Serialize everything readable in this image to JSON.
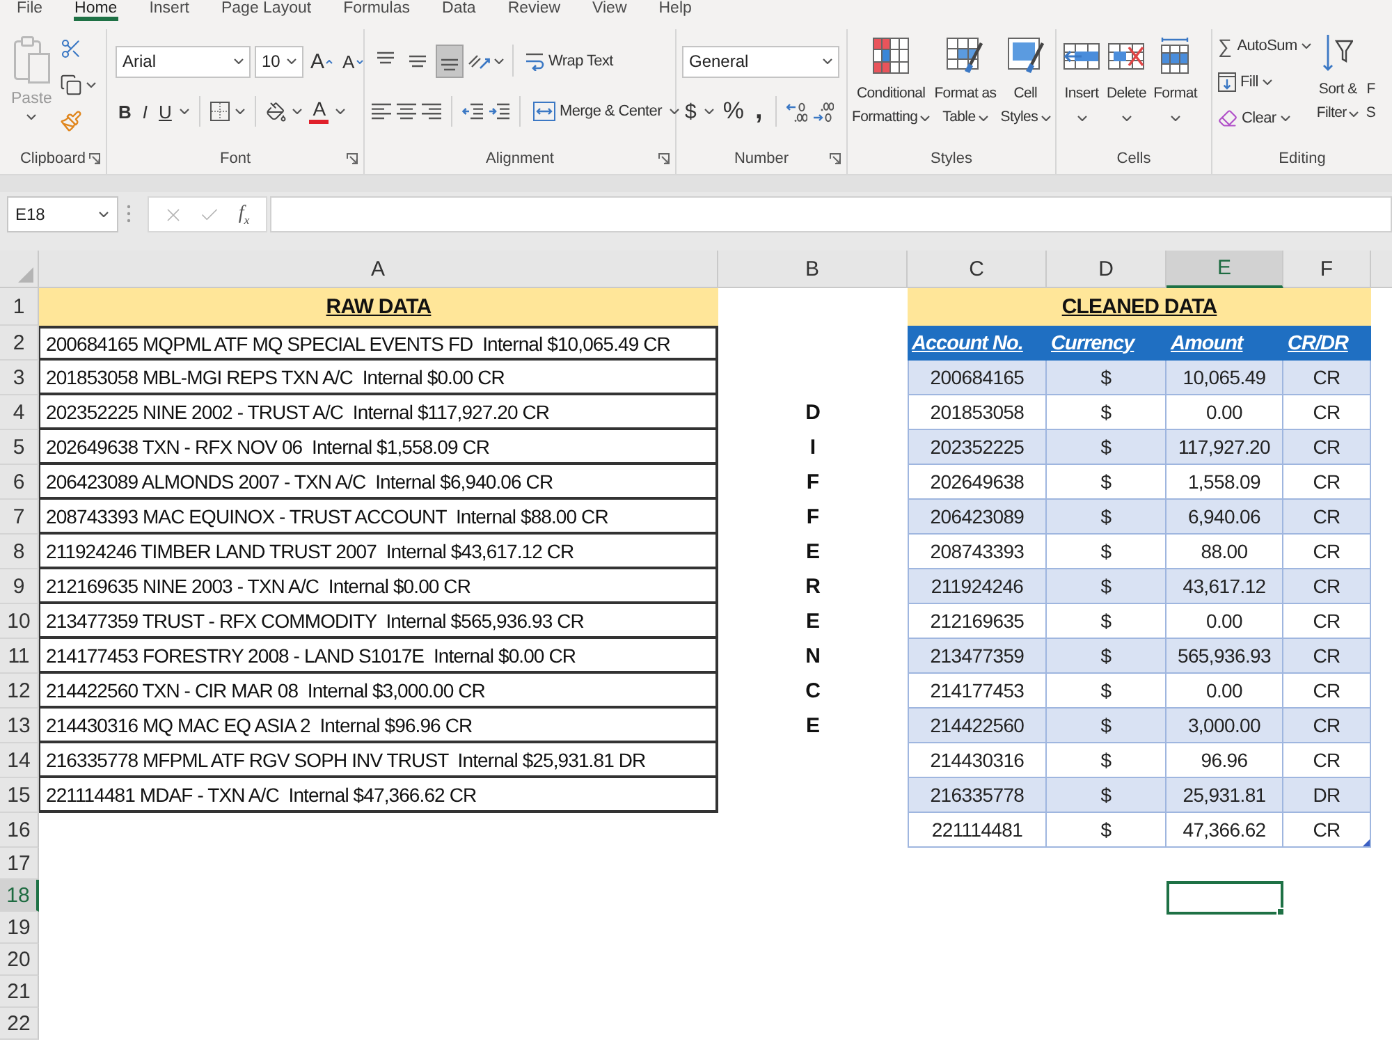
{
  "tabs": [
    {
      "label": "File",
      "selected": false
    },
    {
      "label": "Home",
      "selected": true
    },
    {
      "label": "Insert",
      "selected": false
    },
    {
      "label": "Page Layout",
      "selected": false
    },
    {
      "label": "Formulas",
      "selected": false
    },
    {
      "label": "Data",
      "selected": false
    },
    {
      "label": "Review",
      "selected": false
    },
    {
      "label": "View",
      "selected": false
    },
    {
      "label": "Help",
      "selected": false
    }
  ],
  "ribbon": {
    "clipboard": {
      "label": "Clipboard",
      "paste": {
        "label": "Paste",
        "disabled": true
      }
    },
    "font": {
      "label": "Font",
      "font_name": "Arial",
      "font_size": "10",
      "grow": "A",
      "shrink": "A",
      "bold": "B",
      "italic": "I",
      "underline": "U",
      "font_color": "A"
    },
    "alignment": {
      "label": "Alignment",
      "vertical": [
        {
          "kind": "top",
          "selected": false
        },
        {
          "kind": "middle",
          "selected": false
        },
        {
          "kind": "bottom",
          "selected": true
        }
      ],
      "wrap_text": "Wrap Text",
      "merge": "Merge & Center"
    },
    "number": {
      "label": "Number",
      "format": "General",
      "currency": "$",
      "percent": "%",
      "comma": ","
    },
    "styles": {
      "label": "Styles",
      "buttons": [
        {
          "kind": "conditional",
          "lines": [
            "Conditional",
            "Formatting"
          ]
        },
        {
          "kind": "table",
          "lines": [
            "Format as",
            "Table"
          ]
        },
        {
          "kind": "cell",
          "lines": [
            "Cell",
            "Styles"
          ]
        }
      ]
    },
    "cells": {
      "label": "Cells",
      "buttons": [
        {
          "kind": "insert",
          "label": "Insert"
        },
        {
          "kind": "delete",
          "label": "Delete"
        },
        {
          "kind": "format",
          "label": "Format"
        }
      ]
    },
    "editing": {
      "label": "Editing",
      "autosum_symbol": "∑",
      "autosum": "AutoSum",
      "fill": "Fill",
      "clear": "Clear",
      "sort": [
        "Sort &",
        "Filter"
      ],
      "find": [
        "F",
        "S"
      ]
    }
  },
  "formula_bar": {
    "name_box": "E18",
    "function": "f$_{x}$"
  },
  "sheet": {
    "columns": [
      {
        "label": "A",
        "selected": false
      },
      {
        "label": "B",
        "selected": false
      },
      {
        "label": "C",
        "selected": false
      },
      {
        "label": "D",
        "selected": false
      },
      {
        "label": "E",
        "selected": true
      },
      {
        "label": "F",
        "selected": false
      }
    ],
    "rows": [
      {
        "label": "1",
        "selected": false
      },
      {
        "label": "2",
        "selected": false
      },
      {
        "label": "3",
        "selected": false
      },
      {
        "label": "4",
        "selected": false
      },
      {
        "label": "5",
        "selected": false
      },
      {
        "label": "6",
        "selected": false
      },
      {
        "label": "7",
        "selected": false
      },
      {
        "label": "8",
        "selected": false
      },
      {
        "label": "9",
        "selected": false
      },
      {
        "label": "10",
        "selected": false
      },
      {
        "label": "11",
        "selected": false
      },
      {
        "label": "12",
        "selected": false
      },
      {
        "label": "13",
        "selected": false
      },
      {
        "label": "14",
        "selected": false
      },
      {
        "label": "15",
        "selected": false
      },
      {
        "label": "16",
        "selected": false
      },
      {
        "label": "17",
        "selected": false
      },
      {
        "label": "18",
        "selected": true
      },
      {
        "label": "19",
        "selected": false
      },
      {
        "label": "20",
        "selected": false
      },
      {
        "label": "21",
        "selected": false
      },
      {
        "label": "22",
        "selected": false
      }
    ]
  },
  "raw_data": {
    "title": "RAW DATA",
    "lines": [
      "200684165 MQPML ATF MQ SPECIAL EVENTS FD  Internal $10,065.49 CR",
      "201853058 MBL-MGI REPS TXN A/C  Internal $0.00 CR",
      "202352225 NINE 2002 - TRUST A/C  Internal $117,927.20 CR",
      "202649638 TXN - RFX NOV 06  Internal $1,558.09 CR",
      "206423089 ALMONDS 2007 - TXN A/C  Internal $6,940.06 CR",
      "208743393 MAC EQUINOX - TRUST ACCOUNT  Internal $88.00 CR",
      "211924246 TIMBER LAND TRUST 2007  Internal $43,617.12 CR",
      "212169635 NINE 2003 - TXN A/C  Internal $0.00 CR",
      "213477359 TRUST - RFX COMMODITY  Internal $565,936.93 CR",
      "214177453 FORESTRY 2008 - LAND S1017E  Internal $0.00 CR",
      "214422560 TXN - CIR MAR 08  Internal $3,000.00 CR",
      "214430316 MQ MAC EQ ASIA 2  Internal $96.96 CR",
      "216335778 MFPML ATF RGV SOPH INV TRUST  Internal $25,931.81 DR",
      "221114481 MDAF - TXN A/C  Internal $47,366.62 CR"
    ]
  },
  "difference_label": "DIFFERENCE",
  "cleaned_data": {
    "title": "CLEANED DATA",
    "columns": [
      "Account No.",
      "Currency",
      "Amount",
      "CR/DR"
    ],
    "rows": [
      {
        "account": "200684165",
        "currency": "$",
        "amount": "10,065.49",
        "side": "CR"
      },
      {
        "account": "201853058",
        "currency": "$",
        "amount": "0.00",
        "side": "CR"
      },
      {
        "account": "202352225",
        "currency": "$",
        "amount": "117,927.20",
        "side": "CR"
      },
      {
        "account": "202649638",
        "currency": "$",
        "amount": "1,558.09",
        "side": "CR"
      },
      {
        "account": "206423089",
        "currency": "$",
        "amount": "6,940.06",
        "side": "CR"
      },
      {
        "account": "208743393",
        "currency": "$",
        "amount": "88.00",
        "side": "CR"
      },
      {
        "account": "211924246",
        "currency": "$",
        "amount": "43,617.12",
        "side": "CR"
      },
      {
        "account": "212169635",
        "currency": "$",
        "amount": "0.00",
        "side": "CR"
      },
      {
        "account": "213477359",
        "currency": "$",
        "amount": "565,936.93",
        "side": "CR"
      },
      {
        "account": "214177453",
        "currency": "$",
        "amount": "0.00",
        "side": "CR"
      },
      {
        "account": "214422560",
        "currency": "$",
        "amount": "3,000.00",
        "side": "CR"
      },
      {
        "account": "214430316",
        "currency": "$",
        "amount": "96.96",
        "side": "CR"
      },
      {
        "account": "216335778",
        "currency": "$",
        "amount": "25,931.81",
        "side": "DR"
      },
      {
        "account": "221114481",
        "currency": "$",
        "amount": "47,366.62",
        "side": "CR"
      }
    ]
  }
}
